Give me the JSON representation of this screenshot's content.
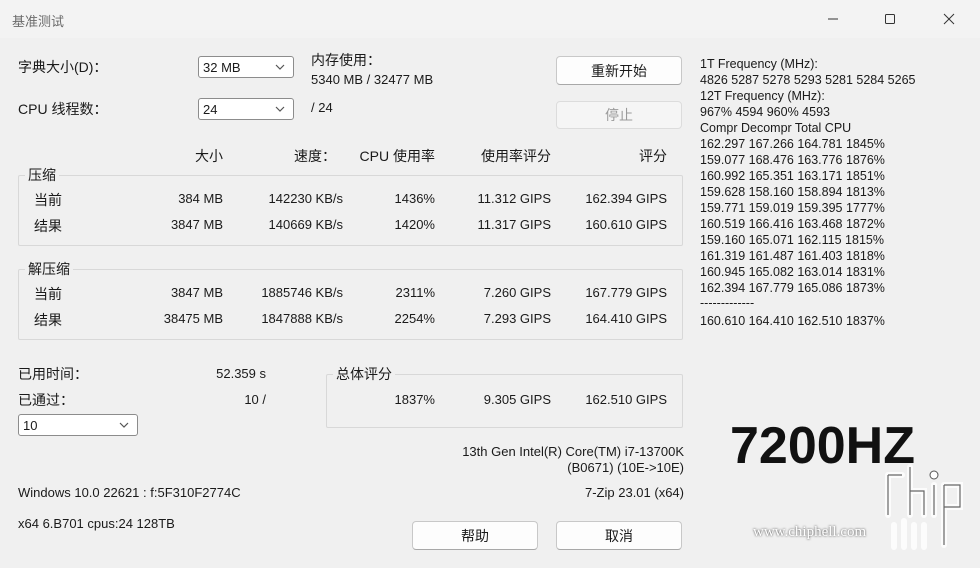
{
  "window": {
    "title": "基准测试"
  },
  "settings": {
    "dict_label": "字典大小(D)：",
    "dict_value": "32 MB",
    "threads_label": "CPU 线程数：",
    "threads_value": "24",
    "threads_total": "/ 24",
    "mem_label": "内存使用：",
    "mem_value": "5340 MB / 32477 MB"
  },
  "buttons": {
    "restart": "重新开始",
    "stop": "停止",
    "help": "帮助",
    "cancel": "取消"
  },
  "columns": {
    "size": "大小",
    "speed": "速度：",
    "cpu_usage": "CPU 使用率",
    "usage_rating": "使用率评分",
    "rating": "评分"
  },
  "compress": {
    "title": "压缩",
    "rows": [
      {
        "label": "当前",
        "size": "384 MB",
        "speed": "142230 KB/s",
        "usage": "1436%",
        "rating_usage": "11.312 GIPS",
        "rating": "162.394 GIPS"
      },
      {
        "label": "结果",
        "size": "3847 MB",
        "speed": "140669 KB/s",
        "usage": "1420%",
        "rating_usage": "11.317 GIPS",
        "rating": "160.610 GIPS"
      }
    ]
  },
  "decompress": {
    "title": "解压缩",
    "rows": [
      {
        "label": "当前",
        "size": "3847 MB",
        "speed": "1885746 KB/s",
        "usage": "2311%",
        "rating_usage": "7.260 GIPS",
        "rating": "167.779 GIPS"
      },
      {
        "label": "结果",
        "size": "38475 MB",
        "speed": "1847888 KB/s",
        "usage": "2254%",
        "rating_usage": "7.293 GIPS",
        "rating": "164.410 GIPS"
      }
    ]
  },
  "status": {
    "elapsed_label": "已用时间：",
    "elapsed_value": "52.359 s",
    "passes_label": "已通过：",
    "passes_value": "10 /",
    "passes_select": "10"
  },
  "total": {
    "title": "总体评分",
    "usage": "1837%",
    "rating_usage": "9.305 GIPS",
    "rating": "162.510 GIPS"
  },
  "system": {
    "cpu_name": "13th Gen Intel(R) Core(TM) i7-13700K",
    "cpu_id": "(B0671) (10E->10E)",
    "os": "Windows 10.0 22621 : f:5F310F2774C",
    "version": "7-Zip 23.01 (x64)",
    "arch": "x64 6.B701 cpus:24 128TB"
  },
  "freq": {
    "l1": "1T Frequency (MHz):",
    "l2": "4826 5287 5278 5293 5281 5284 5265",
    "l3": "12T Frequency (MHz):",
    "l4": "967% 4594 960% 4593",
    "l5": "Compr Decompr Total   CPU",
    "l6": "162.297  167.266  164.781  1845%",
    "l7": "159.077  168.476  163.776  1876%",
    "l8": "160.992  165.351  163.171  1851%",
    "l9": "159.628  158.160  158.894  1813%",
    "l10": "159.771  159.019  159.395  1777%",
    "l11": "160.519  166.416  163.468  1872%",
    "l12": "159.160  165.071  162.115  1815%",
    "l13": "161.319  161.487  161.403  1818%",
    "l14": "160.945  165.082  163.014  1831%",
    "l15": "162.394  167.779  165.086  1873%",
    "l16": "-------------",
    "l17": "160.610  164.410  162.510  1837%"
  },
  "watermark": {
    "big": "7200HZ",
    "url": "www.chiphell.com"
  },
  "icons": {
    "minimize": "minimize-icon",
    "maximize": "maximize-icon",
    "close": "close-icon",
    "dropdown": "chevron-down-icon"
  }
}
